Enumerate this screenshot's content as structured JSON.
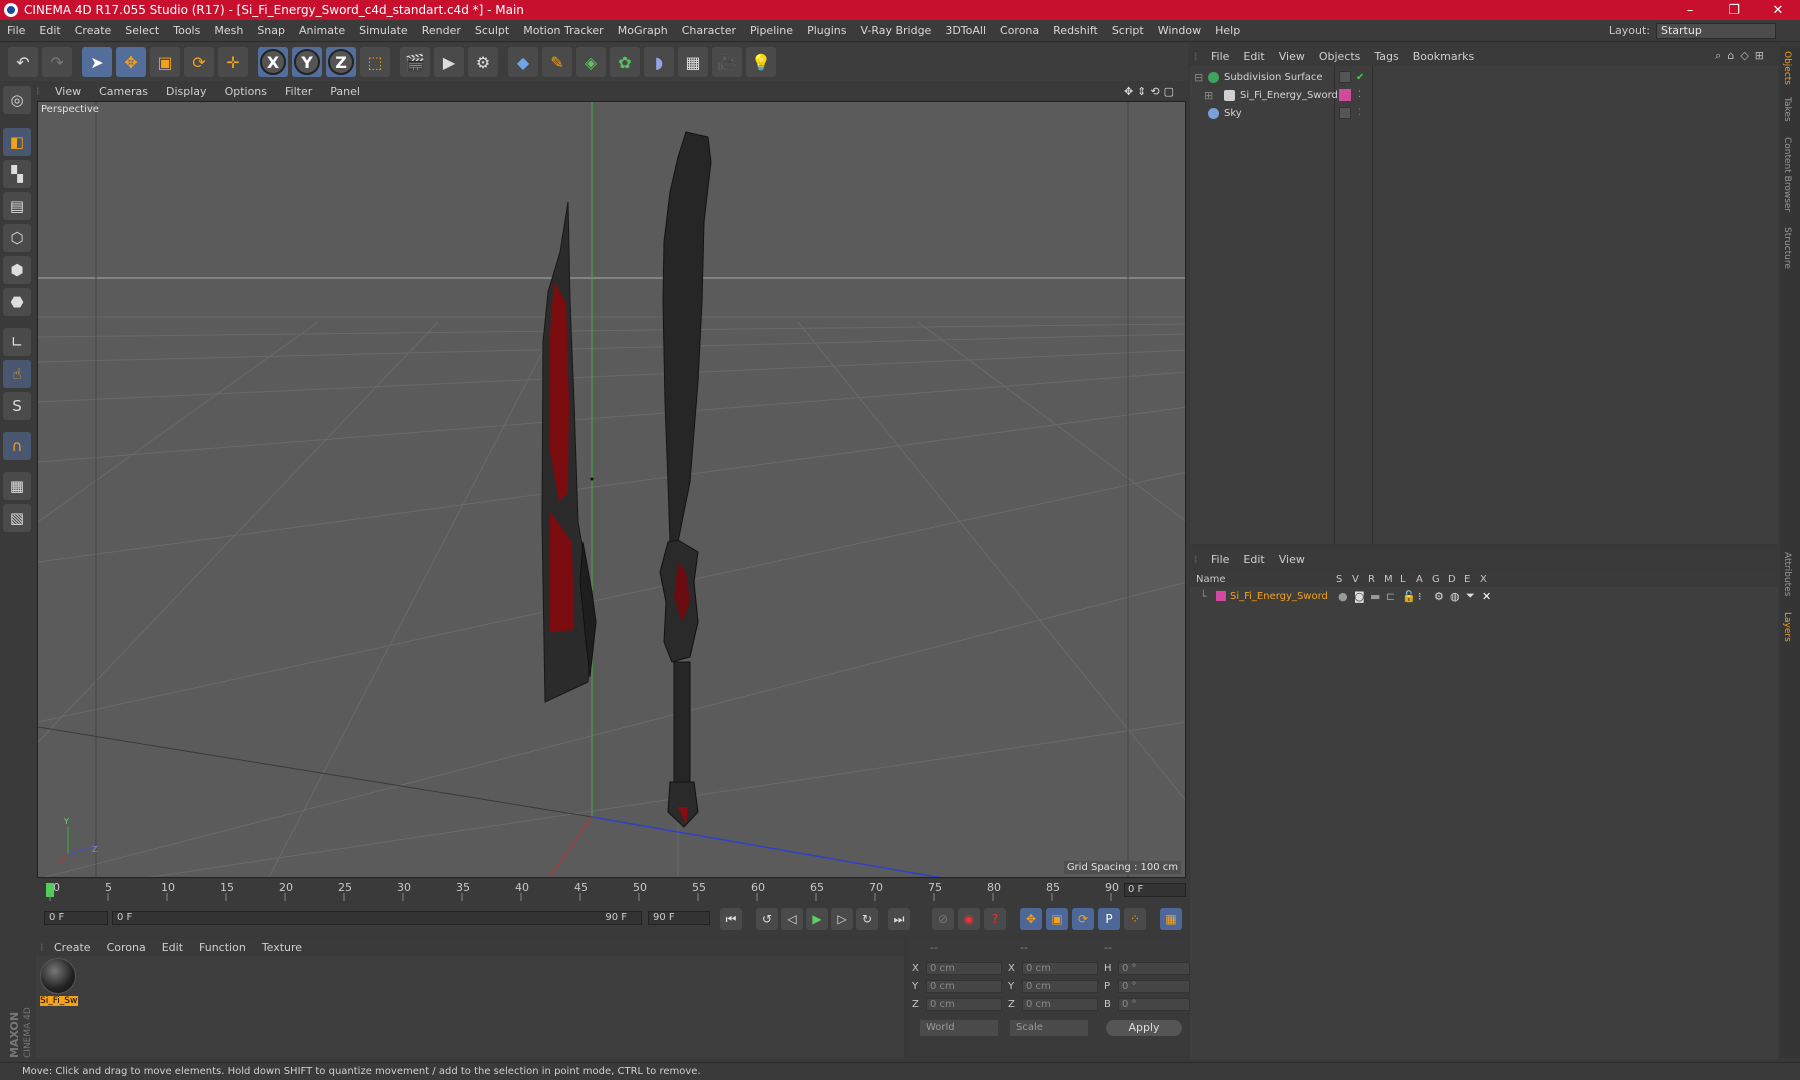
{
  "app": {
    "title": "CINEMA 4D R17.055 Studio (R17) - [Si_Fi_Energy_Sword_c4d_standart.c4d *] - Main",
    "window_buttons": [
      "–",
      "❐",
      "✕"
    ],
    "brand_colors": {
      "titlebar": "#c8102e",
      "accent": "#f3a21a",
      "selection_blue": "#536e9a"
    }
  },
  "menubar": {
    "items": [
      "File",
      "Edit",
      "Create",
      "Select",
      "Tools",
      "Mesh",
      "Snap",
      "Animate",
      "Simulate",
      "Render",
      "Sculpt",
      "Motion Tracker",
      "MoGraph",
      "Character",
      "Pipeline",
      "Plugins",
      "V-Ray Bridge",
      "3DToAll",
      "Corona",
      "Redshift",
      "Script",
      "Window",
      "Help"
    ],
    "layout_label": "Layout:",
    "layout_value": "Startup"
  },
  "viewport": {
    "menu": [
      "View",
      "Cameras",
      "Display",
      "Options",
      "Filter",
      "Panel"
    ],
    "label": "Perspective",
    "grid_spacing": "Grid Spacing : 100 cm"
  },
  "timeline": {
    "ticks": [
      "0",
      "5",
      "10",
      "15",
      "20",
      "25",
      "30",
      "35",
      "40",
      "45",
      "50",
      "55",
      "60",
      "65",
      "70",
      "75",
      "80",
      "85",
      "90"
    ],
    "current_frame": "0 F",
    "start_field": "0 F",
    "range_start": "0 F",
    "range_end": "90 F",
    "end_field": "90 F"
  },
  "material_manager": {
    "menu": [
      "Create",
      "Corona",
      "Edit",
      "Function",
      "Texture"
    ],
    "material_name": "Si_Fi_Sw"
  },
  "coordinates": {
    "headers": [
      "--",
      "--",
      "--"
    ],
    "rows": [
      {
        "a": "X",
        "av": "0 cm",
        "b": "X",
        "bv": "0 cm",
        "c": "H",
        "cv": "0 °"
      },
      {
        "a": "Y",
        "av": "0 cm",
        "b": "Y",
        "bv": "0 cm",
        "c": "P",
        "cv": "0 °"
      },
      {
        "a": "Z",
        "av": "0 cm",
        "b": "Z",
        "bv": "0 cm",
        "c": "B",
        "cv": "0 °"
      }
    ],
    "mode": "World",
    "scale": "Scale",
    "apply": "Apply"
  },
  "object_manager": {
    "menu": [
      "File",
      "Edit",
      "View",
      "Objects",
      "Tags",
      "Bookmarks"
    ],
    "objects": [
      {
        "name": "Subdivision Surface",
        "icon_color": "#3fa55a"
      },
      {
        "name": "Si_Fi_Energy_Sword",
        "icon_color": "#e0e0e0",
        "tag_color": "#d24aa0"
      },
      {
        "name": "Sky",
        "icon_color": "#7aa0d8"
      }
    ]
  },
  "layer_manager": {
    "menu": [
      "File",
      "Edit",
      "View"
    ],
    "columns": [
      "Name",
      "S",
      "V",
      "R",
      "M",
      "L",
      "A",
      "G",
      "D",
      "E",
      "X"
    ],
    "layers": [
      {
        "name": "Si_Fi_Energy_Sword",
        "color": "#d24aa0"
      }
    ]
  },
  "right_tabs": [
    "Objects",
    "Takes",
    "Content Browser",
    "Structure",
    "Attributes",
    "Layers"
  ],
  "status": "Move: Click and drag to move elements. Hold down SHIFT to quantize movement / add to the selection in point mode, CTRL to remove.",
  "maxon_logo": "MAXON CINEMA 4D"
}
